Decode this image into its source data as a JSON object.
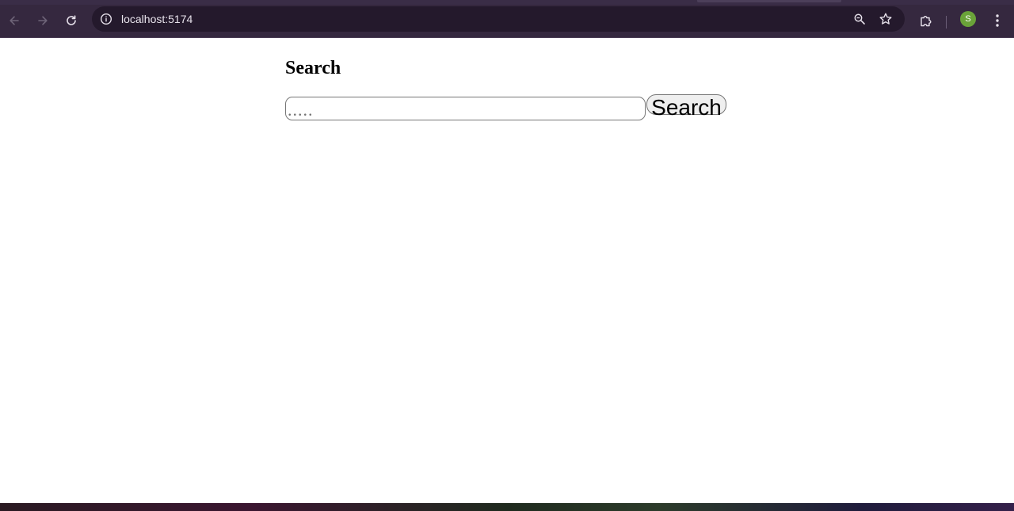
{
  "browser": {
    "url": "localhost:5174",
    "profile_initial": "S",
    "icons": {
      "back": "arrow-left-icon",
      "forward": "arrow-right-icon",
      "reload": "reload-icon",
      "site_info": "info-icon",
      "zoom": "zoom-icon",
      "bookmark": "star-icon",
      "extensions": "puzzle-icon",
      "menu": "kebab-menu-icon"
    },
    "colors": {
      "toolbar": "#35283f",
      "omnibox": "#24192c",
      "avatar": "#6aa339"
    }
  },
  "page": {
    "title": "Search",
    "search": {
      "value": "",
      "placeholder": "....."
    },
    "search_button_label": "Search"
  }
}
